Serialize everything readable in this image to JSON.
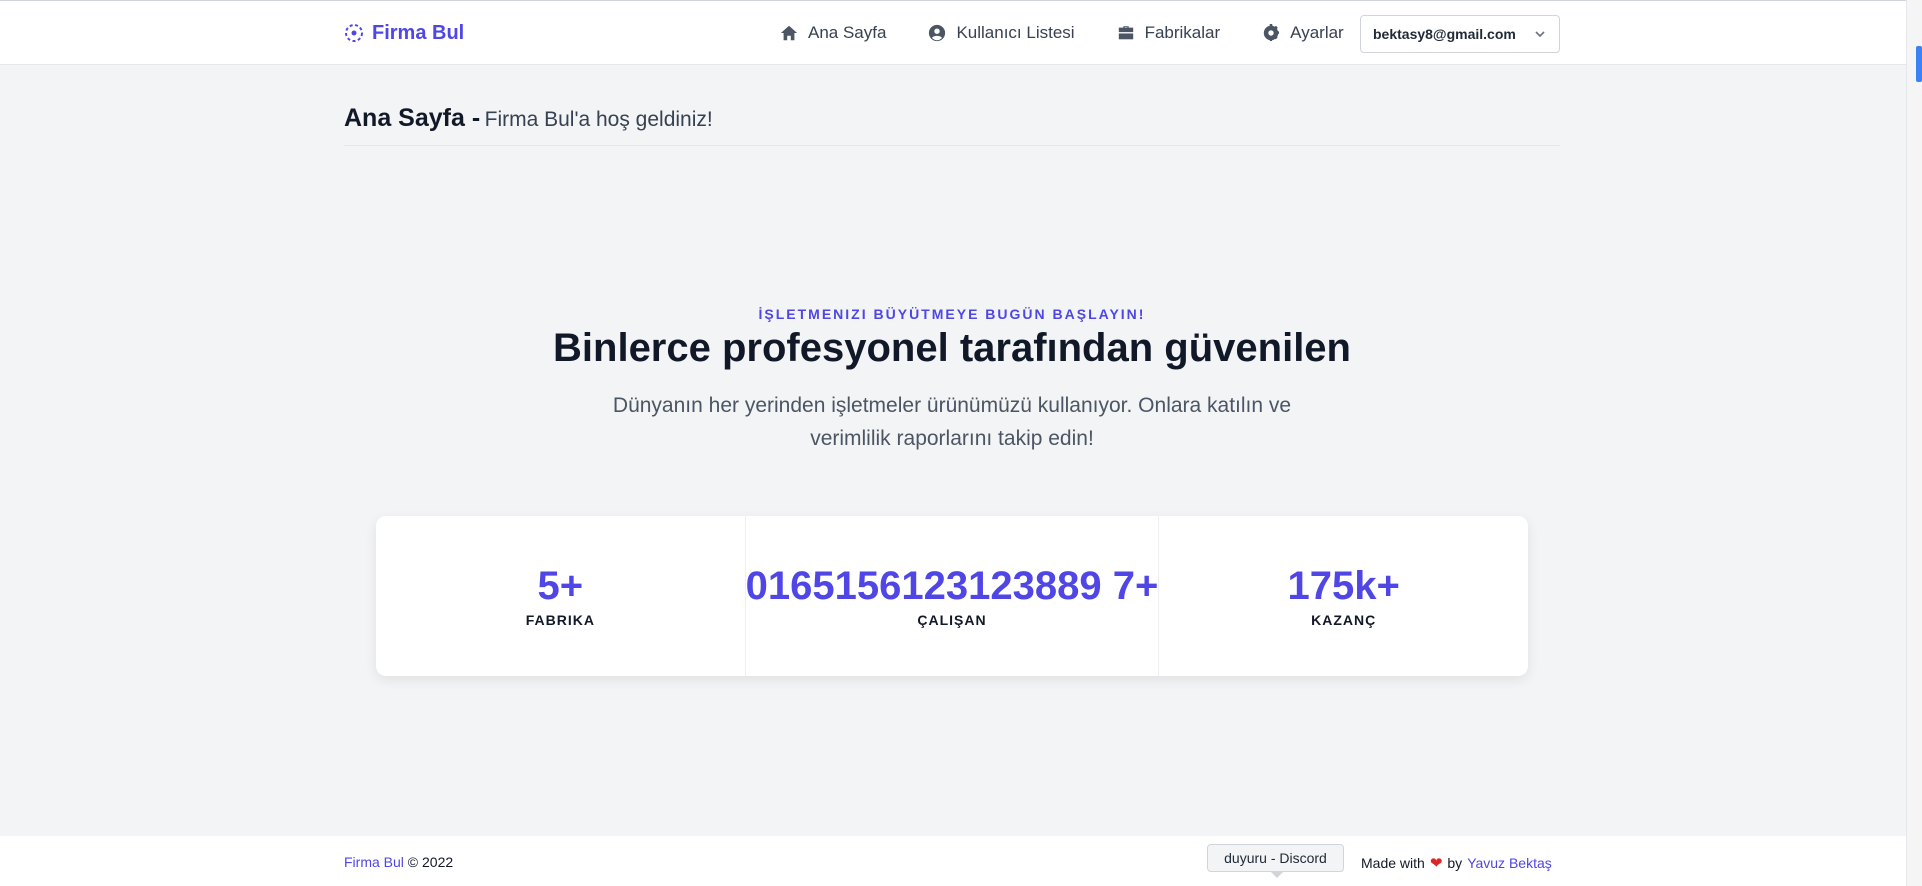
{
  "header": {
    "brand": "Firma Bul",
    "nav": [
      {
        "label": "Ana Sayfa",
        "icon": "home-icon"
      },
      {
        "label": "Kullanıcı Listesi",
        "icon": "user-circle-icon"
      },
      {
        "label": "Fabrikalar",
        "icon": "briefcase-icon"
      },
      {
        "label": "Ayarlar",
        "icon": "gear-icon"
      }
    ],
    "user_email": "bektasy8@gmail.com"
  },
  "page": {
    "title": "Ana Sayfa -",
    "subtitle": "Firma Bul'a hoş geldiniz!"
  },
  "hero": {
    "eyebrow": "İŞLETMENIZI BÜYÜTMEYE BUGÜN BAŞLAYIN!",
    "title": "Binlerce profesyonel tarafından güvenilen",
    "description": "Dünyanın her yerinden işletmeler ürünümüzü kullanıyor. Onlara katılın ve verimlilik raporlarını takip edin!"
  },
  "stats": [
    {
      "value": "5+",
      "label": "FABRIKA"
    },
    {
      "value": "0165156123123889 7+",
      "label": "ÇALIŞAN"
    },
    {
      "value": "175k+",
      "label": "KAZANÇ"
    }
  ],
  "footer": {
    "brand_link": "Firma Bul",
    "copyright": "© 2022",
    "made_with": "Made with",
    "by": "by",
    "author": "Yavuz Bektaş",
    "tooltip": "duyuru - Discord"
  },
  "colors": {
    "accent": "#4f46e5",
    "heart": "#dc2626"
  }
}
